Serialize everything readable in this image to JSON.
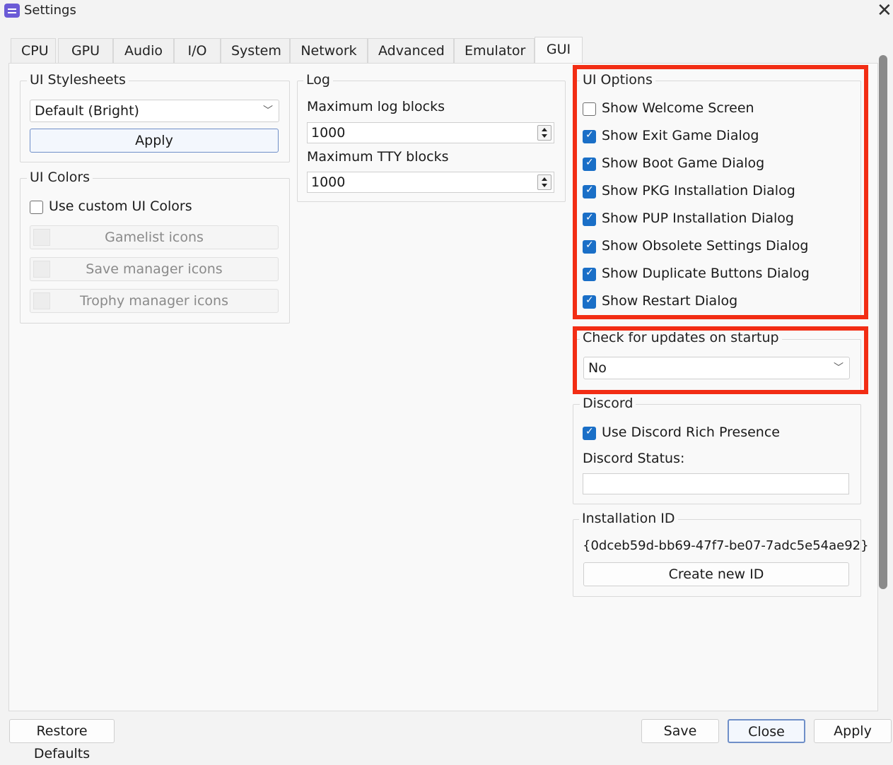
{
  "window": {
    "title": "Settings"
  },
  "tabs": [
    "CPU",
    "GPU",
    "Audio",
    "I/O",
    "System",
    "Network",
    "Advanced",
    "Emulator",
    "GUI"
  ],
  "ui_stylesheets": {
    "label": "UI Stylesheets",
    "selected": "Default (Bright)",
    "apply_label": "Apply"
  },
  "ui_colors": {
    "label": "UI Colors",
    "use_custom_label": "Use custom UI Colors",
    "use_custom_checked": false,
    "buttons": [
      "Gamelist icons",
      "Save manager icons",
      "Trophy manager icons"
    ]
  },
  "log": {
    "label": "Log",
    "max_log_label": "Maximum log blocks",
    "max_log_value": "1000",
    "max_tty_label": "Maximum TTY blocks",
    "max_tty_value": "1000"
  },
  "ui_options": {
    "label": "UI Options",
    "items": [
      {
        "label": "Show Welcome Screen",
        "checked": false
      },
      {
        "label": "Show Exit Game Dialog",
        "checked": true
      },
      {
        "label": "Show Boot Game Dialog",
        "checked": true
      },
      {
        "label": "Show PKG Installation Dialog",
        "checked": true
      },
      {
        "label": "Show PUP Installation Dialog",
        "checked": true
      },
      {
        "label": "Show Obsolete Settings Dialog",
        "checked": true
      },
      {
        "label": "Show Duplicate Buttons Dialog",
        "checked": true
      },
      {
        "label": "Show Restart Dialog",
        "checked": true
      }
    ]
  },
  "updates": {
    "label": "Check for updates on startup",
    "selected": "No"
  },
  "discord": {
    "label": "Discord",
    "rich_presence_label": "Use Discord Rich Presence",
    "rich_presence_checked": true,
    "status_label": "Discord Status:",
    "status_value": ""
  },
  "installation": {
    "label": "Installation ID",
    "id": "{0dceb59d-bb69-47f7-be07-7adc5e54ae92}",
    "create_label": "Create new ID"
  },
  "footer": {
    "restore_label": "Restore Defaults",
    "save_label": "Save",
    "close_label": "Close",
    "apply_label": "Apply"
  },
  "colors": {
    "highlight": "#f22d14",
    "checkbox_accent": "#1a6fc7"
  }
}
